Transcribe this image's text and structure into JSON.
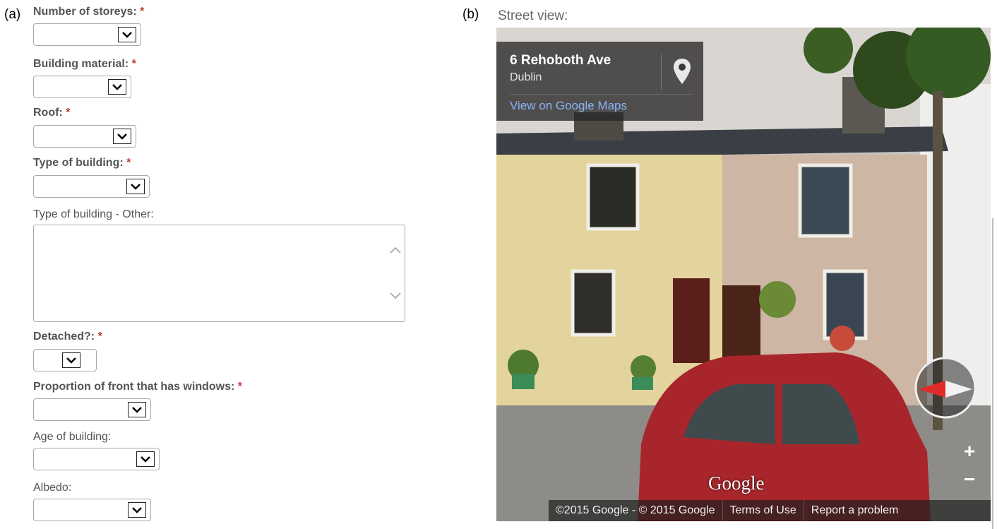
{
  "panels": {
    "a": "(a)",
    "b": "(b)"
  },
  "form": {
    "required_mark": "*",
    "fields": [
      {
        "label": "Number of storeys:",
        "required": true
      },
      {
        "label": "Building material:",
        "required": true
      },
      {
        "label": "Roof:",
        "required": true
      },
      {
        "label": "Type of building:",
        "required": true
      },
      {
        "label": "Type of building - Other:",
        "required": false
      },
      {
        "label": "Detached?:",
        "required": true
      },
      {
        "label": "Proportion of front that has windows:",
        "required": true
      },
      {
        "label": "Age of building:",
        "required": false
      },
      {
        "label": "Albedo:",
        "required": false
      }
    ]
  },
  "street_view": {
    "heading": "Street view:",
    "address_title": "6 Rehoboth Ave",
    "address_city": "Dublin",
    "maps_link": "View on Google Maps",
    "logo": "Google",
    "zoom_in": "+",
    "zoom_out": "−",
    "attribution": {
      "copyright": "©2015 Google - © 2015 Google",
      "terms": "Terms of Use",
      "report": "Report a problem"
    }
  }
}
